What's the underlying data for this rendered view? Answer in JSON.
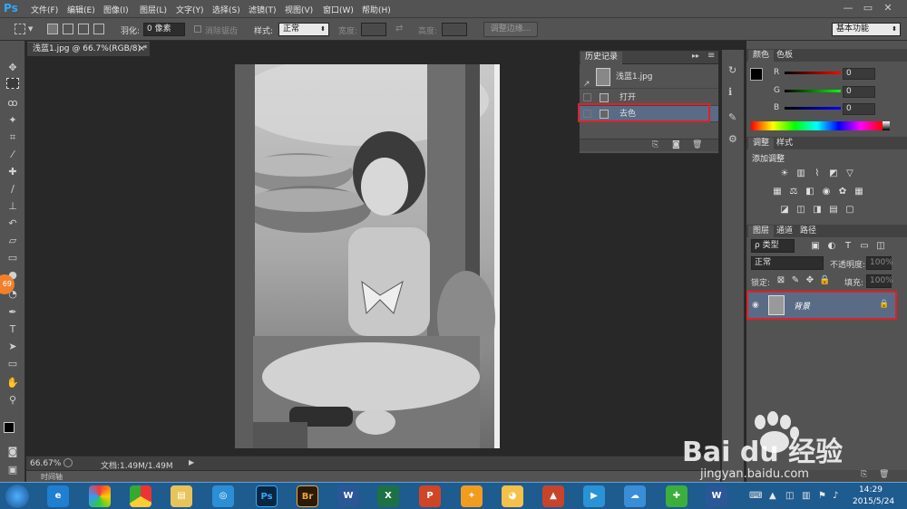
{
  "app": {
    "logo": "Ps"
  },
  "menu": [
    "文件(F)",
    "编辑(E)",
    "图像(I)",
    "图层(L)",
    "文字(Y)",
    "选择(S)",
    "滤镜(T)",
    "视图(V)",
    "窗口(W)",
    "帮助(H)"
  ],
  "options": {
    "feather_label": "羽化:",
    "feather_value": "0 像素",
    "antialias_label": "消除锯齿",
    "style_label": "样式:",
    "style_value": "正常",
    "width_label": "宽度:",
    "height_label": "高度:",
    "refine_edge": "调整边缘...",
    "workspace": "基本功能"
  },
  "document": {
    "tab_title": "浅蓝1.jpg @ 66.7%(RGB/8) *",
    "tab_close": "×",
    "zoom": "66.67%",
    "doc_size": "文档:1.49M/1.49M",
    "timeline_label": "时间轴"
  },
  "history": {
    "title": "历史记录",
    "snapshot": "浅蓝1.jpg",
    "items": [
      {
        "label": "打开"
      },
      {
        "label": "去色"
      }
    ]
  },
  "color_panel": {
    "tabs": [
      "颜色",
      "色板"
    ],
    "r_label": "R",
    "r_value": "0",
    "g_label": "G",
    "g_value": "0",
    "b_label": "B",
    "b_value": "0"
  },
  "adjust_panel": {
    "tabs": [
      "调整",
      "样式"
    ],
    "title": "添加调整"
  },
  "layers_panel": {
    "tabs": [
      "图层",
      "通道",
      "路径"
    ],
    "filter_kind": "ρ 类型",
    "blend_mode": "正常",
    "opacity_label": "不透明度:",
    "opacity_value": "100%",
    "lock_label": "锁定:",
    "fill_label": "填充:",
    "fill_value": "100%",
    "layer_name": "背景"
  },
  "taskbar": {
    "time": "14:29",
    "date": "2015/5/24",
    "apps": [
      "ps",
      "br",
      "word",
      "excel",
      "ppt"
    ],
    "app_labels": {
      "ps": "Ps",
      "br": "Br",
      "word": "W",
      "excel": "X",
      "ppt": "P"
    }
  },
  "watermark": {
    "brand": "Bai du 经验",
    "url": "jingyan.baidu.com"
  },
  "badge": "69",
  "colors": {
    "highlight_red": "#e0202a",
    "ps_blue": "#31a8ff",
    "selected_layer": "#5a6b85"
  }
}
